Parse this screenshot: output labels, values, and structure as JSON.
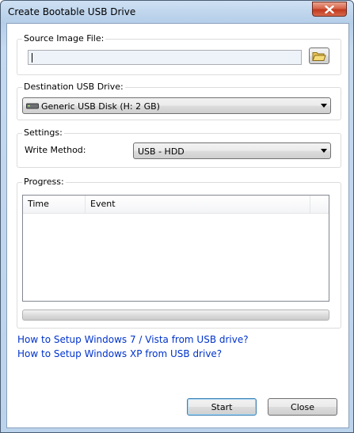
{
  "window": {
    "title": "Create Bootable USB Drive"
  },
  "source": {
    "label": "Source Image File:",
    "value": ""
  },
  "destination": {
    "label": "Destination USB Drive:",
    "selected": "Generic USB Disk (H: 2 GB)"
  },
  "settings": {
    "label": "Settings:",
    "write_method_label": "Write Method:",
    "write_method_value": "USB - HDD"
  },
  "progress": {
    "label": "Progress:",
    "columns": [
      "Time",
      "Event"
    ],
    "percent": 0
  },
  "links": [
    "How to Setup Windows 7 / Vista from USB drive?",
    "How to Setup Windows XP from USB drive?"
  ],
  "buttons": {
    "start": "Start",
    "close": "Close"
  },
  "icons": {
    "close": "close-icon",
    "browse": "folder-icon",
    "drive": "usb-drive-icon",
    "dropdown": "chevron-down-icon"
  }
}
